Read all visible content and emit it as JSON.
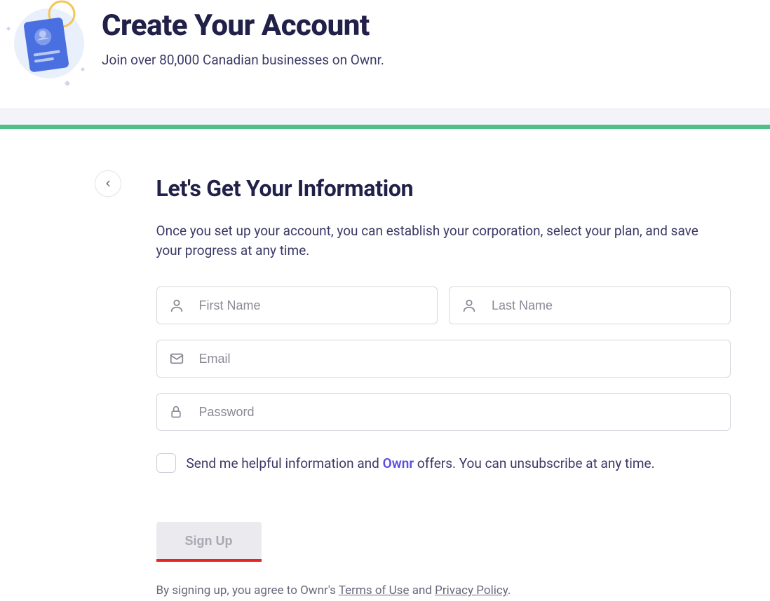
{
  "header": {
    "title": "Create Your Account",
    "subtitle": "Join over 80,000 Canadian businesses on Ownr."
  },
  "section": {
    "title": "Let's Get Your Information",
    "description": "Once you set up your account, you can establish your corporation, select your plan, and save your progress at any time."
  },
  "form": {
    "first_name_placeholder": "First Name",
    "last_name_placeholder": "Last Name",
    "email_placeholder": "Email",
    "password_placeholder": "Password",
    "checkbox_text_prefix": "Send me helpful information and ",
    "checkbox_brand": "Ownr",
    "checkbox_text_suffix": " offers. You can unsubscribe at any time.",
    "signup_label": "Sign Up"
  },
  "legal": {
    "prefix": "By signing up, you agree to Ownr's ",
    "terms_label": "Terms of Use",
    "middle": " and ",
    "privacy_label": "Privacy Policy",
    "suffix": "."
  },
  "colors": {
    "accent": "#5b4ee0",
    "progress": "#4fbf8a",
    "danger": "#e52521"
  }
}
